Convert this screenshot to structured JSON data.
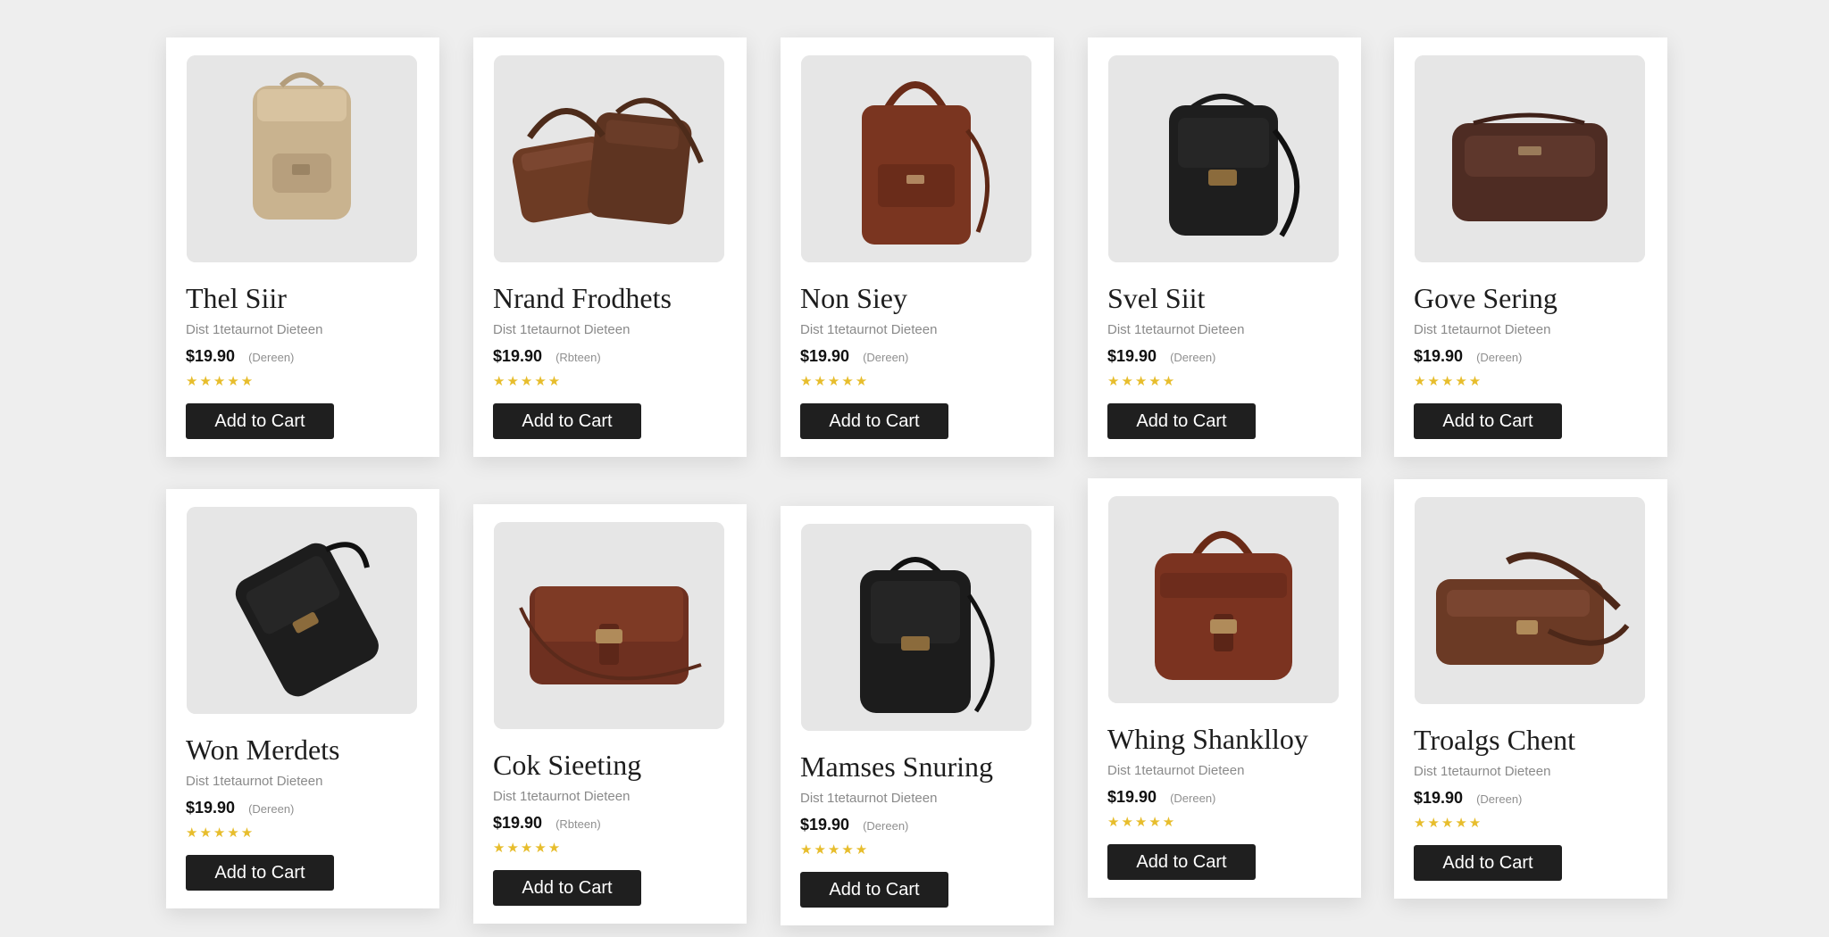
{
  "products": [
    {
      "title": "Thel Siir",
      "subtitle": "Dist 1tetaurnot Dieteen",
      "price": "$19.90",
      "price_note": "(Dereen)",
      "stars": "★★★★★",
      "button": "Add to Cart"
    },
    {
      "title": "Nrand Frodhets",
      "subtitle": "Dist 1tetaurnot Dieteen",
      "price": "$19.90",
      "price_note": "(Rbteen)",
      "stars": "★★★★★",
      "button": "Add to Cart"
    },
    {
      "title": "Non Siey",
      "subtitle": "Dist 1tetaurnot Dieteen",
      "price": "$19.90",
      "price_note": "(Dereen)",
      "stars": "★★★★★",
      "button": "Add to Cart"
    },
    {
      "title": "Svel Siit",
      "subtitle": "Dist 1tetaurnot Dieteen",
      "price": "$19.90",
      "price_note": "(Dereen)",
      "stars": "★★★★★",
      "button": "Add to Cart"
    },
    {
      "title": "Gove Sering",
      "subtitle": "Dist 1tetaurnot Dieteen",
      "price": "$19.90",
      "price_note": "(Dereen)",
      "stars": "★★★★★",
      "button": "Add to Cart"
    },
    {
      "title": "Won Merdets",
      "subtitle": "Dist 1tetaurnot Dieteen",
      "price": "$19.90",
      "price_note": "(Dereen)",
      "stars": "★★★★★",
      "button": "Add to Cart"
    },
    {
      "title": "Cok Sieeting",
      "subtitle": "Dist 1tetaurnot Dieteen",
      "price": "$19.90",
      "price_note": "(Rbteen)",
      "stars": "★★★★★",
      "button": "Add to Cart"
    },
    {
      "title": "Mamses Snuring",
      "subtitle": "Dist 1tetaurnot Dieteen",
      "price": "$19.90",
      "price_note": "(Dereen)",
      "stars": "★★★★★",
      "button": "Add to Cart"
    },
    {
      "title": "Whing Shanklloy",
      "subtitle": "Dist 1tetaurnot Dieteen",
      "price": "$19.90",
      "price_note": "(Dereen)",
      "stars": "★★★★★",
      "button": "Add to Cart"
    },
    {
      "title": "Troalgs Chent",
      "subtitle": "Dist 1tetaurnot Dieteen",
      "price": "$19.90",
      "price_note": "(Dereen)",
      "stars": "★★★★★",
      "button": "Add to Cart"
    }
  ],
  "colors": {
    "page_bg": "#eeeeee",
    "card_bg": "#ffffff",
    "image_bg": "#e6e6e6",
    "button_bg": "#1f1f1f",
    "star": "#e7bd2c"
  }
}
